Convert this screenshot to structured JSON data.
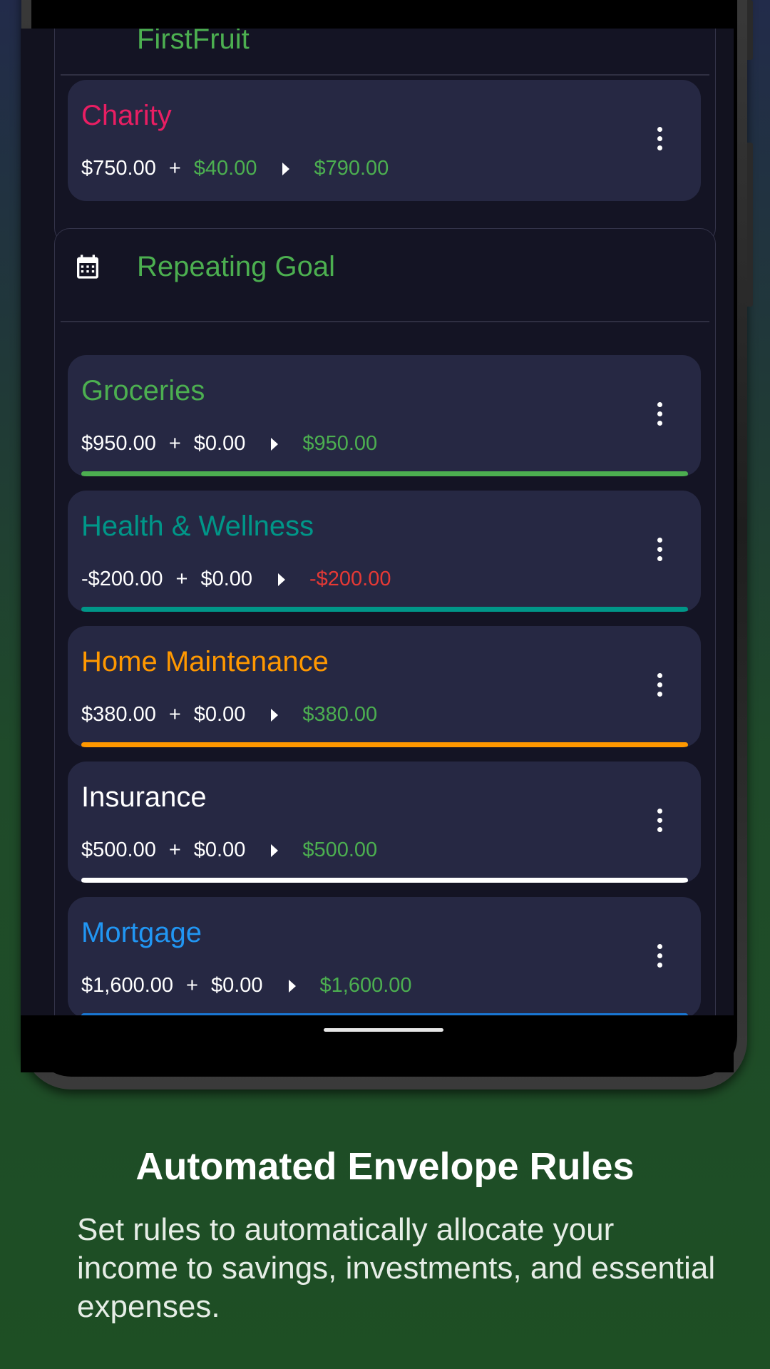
{
  "partial_group": {
    "title": "FirstFruit"
  },
  "goal_group": {
    "title": "Repeating Goal",
    "icon": "calendar-icon"
  },
  "envelopes": [
    {
      "id": "charity",
      "name": "Charity",
      "name_color": "#e91e63",
      "balance": "$750.00",
      "plus": "+",
      "added": "$40.00",
      "added_color": "#4caf50",
      "total": "$790.00",
      "total_color": "#4caf50",
      "bar_color": ""
    },
    {
      "id": "groceries",
      "name": "Groceries",
      "name_color": "#4caf50",
      "balance": "$950.00",
      "plus": "+",
      "added": "$0.00",
      "added_color": "#ffffff",
      "total": "$950.00",
      "total_color": "#4caf50",
      "bar_color": "#4caf50"
    },
    {
      "id": "health",
      "name": "Health & Wellness",
      "name_color": "#009688",
      "balance": "-$200.00",
      "plus": "+",
      "added": "$0.00",
      "added_color": "#ffffff",
      "total": "-$200.00",
      "total_color": "#e53935",
      "bar_color": "#009688"
    },
    {
      "id": "home",
      "name": "Home Maintenance",
      "name_color": "#ff9800",
      "balance": "$380.00",
      "plus": "+",
      "added": "$0.00",
      "added_color": "#ffffff",
      "total": "$380.00",
      "total_color": "#4caf50",
      "bar_color": "#ff9800"
    },
    {
      "id": "insurance",
      "name": "Insurance",
      "name_color": "#ffffff",
      "balance": "$500.00",
      "plus": "+",
      "added": "$0.00",
      "added_color": "#ffffff",
      "total": "$500.00",
      "total_color": "#4caf50",
      "bar_color": "#ffffff"
    },
    {
      "id": "mortgage",
      "name": "Mortgage",
      "name_color": "#2196f3",
      "balance": "$1,600.00",
      "plus": "+",
      "added": "$0.00",
      "added_color": "#ffffff",
      "total": "$1,600.00",
      "total_color": "#4caf50",
      "bar_color": "#1976d2"
    }
  ],
  "caption": {
    "title": "Automated Envelope Rules",
    "body": "Set rules to automatically allocate your income to savings, investments, and essential expenses."
  }
}
